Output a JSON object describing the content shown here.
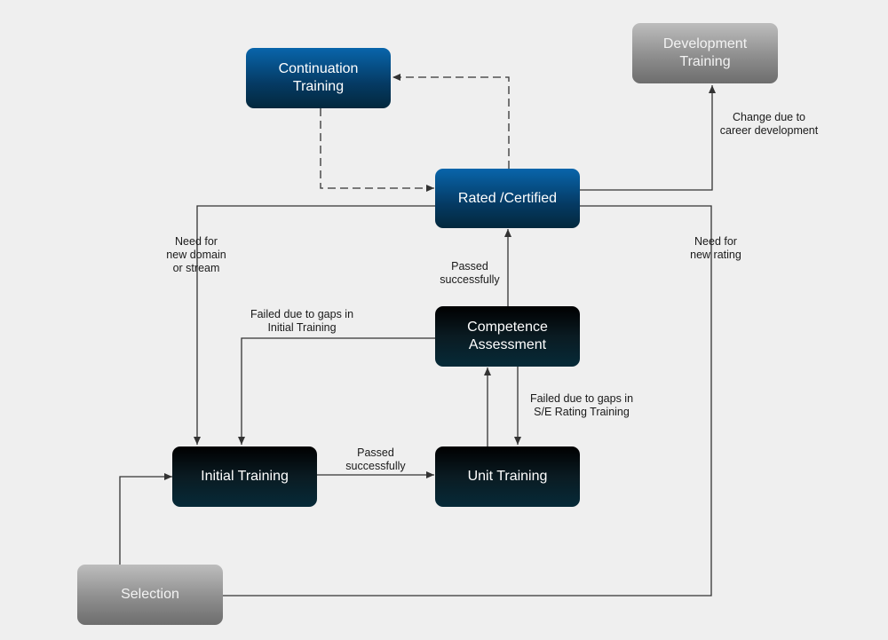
{
  "diagram": {
    "type": "flowchart",
    "nodes": {
      "continuation": {
        "label": "Continuation\nTraining",
        "style": "blue"
      },
      "development": {
        "label": "Development\nTraining",
        "style": "grey"
      },
      "rated": {
        "label": "Rated /Certified",
        "style": "blue"
      },
      "competence": {
        "label": "Competence\nAssessment",
        "style": "dark"
      },
      "initial": {
        "label": "Initial Training",
        "style": "dark"
      },
      "unit": {
        "label": "Unit Training",
        "style": "dark"
      },
      "selection": {
        "label": "Selection",
        "style": "grey"
      }
    },
    "edge_labels": {
      "career_change": "Change due to\ncareer development",
      "new_domain": "Need for\nnew domain\nor stream",
      "new_rating": "Need for\nnew rating",
      "competence_passed": "Passed\nsuccessfully",
      "failed_initial": "Failed due to gaps in\nInitial Training",
      "failed_se": "Failed due to gaps in\nS/E Rating Training",
      "initial_passed": "Passed\nsuccessfully"
    },
    "edges": [
      {
        "from": "continuation",
        "to": "rated",
        "style": "dashed"
      },
      {
        "from": "rated",
        "to": "continuation",
        "style": "dashed"
      },
      {
        "from": "rated",
        "to": "development",
        "label": "career_change"
      },
      {
        "from": "rated",
        "to": "initial",
        "label": "new_domain"
      },
      {
        "from": "selection",
        "to": "rated",
        "label": "new_rating"
      },
      {
        "from": "competence",
        "to": "rated",
        "label": "competence_passed"
      },
      {
        "from": "competence",
        "to": "initial",
        "label": "failed_initial"
      },
      {
        "from": "competence",
        "to": "unit",
        "label": "failed_se"
      },
      {
        "from": "unit",
        "to": "competence"
      },
      {
        "from": "initial",
        "to": "unit",
        "label": "initial_passed"
      },
      {
        "from": "selection",
        "to": "initial"
      }
    ],
    "colors": {
      "background": "#efefef",
      "line": "#333333",
      "blue_node": "#0865ab",
      "dark_node": "#06222d",
      "grey_node": "#8e8e8e"
    }
  }
}
